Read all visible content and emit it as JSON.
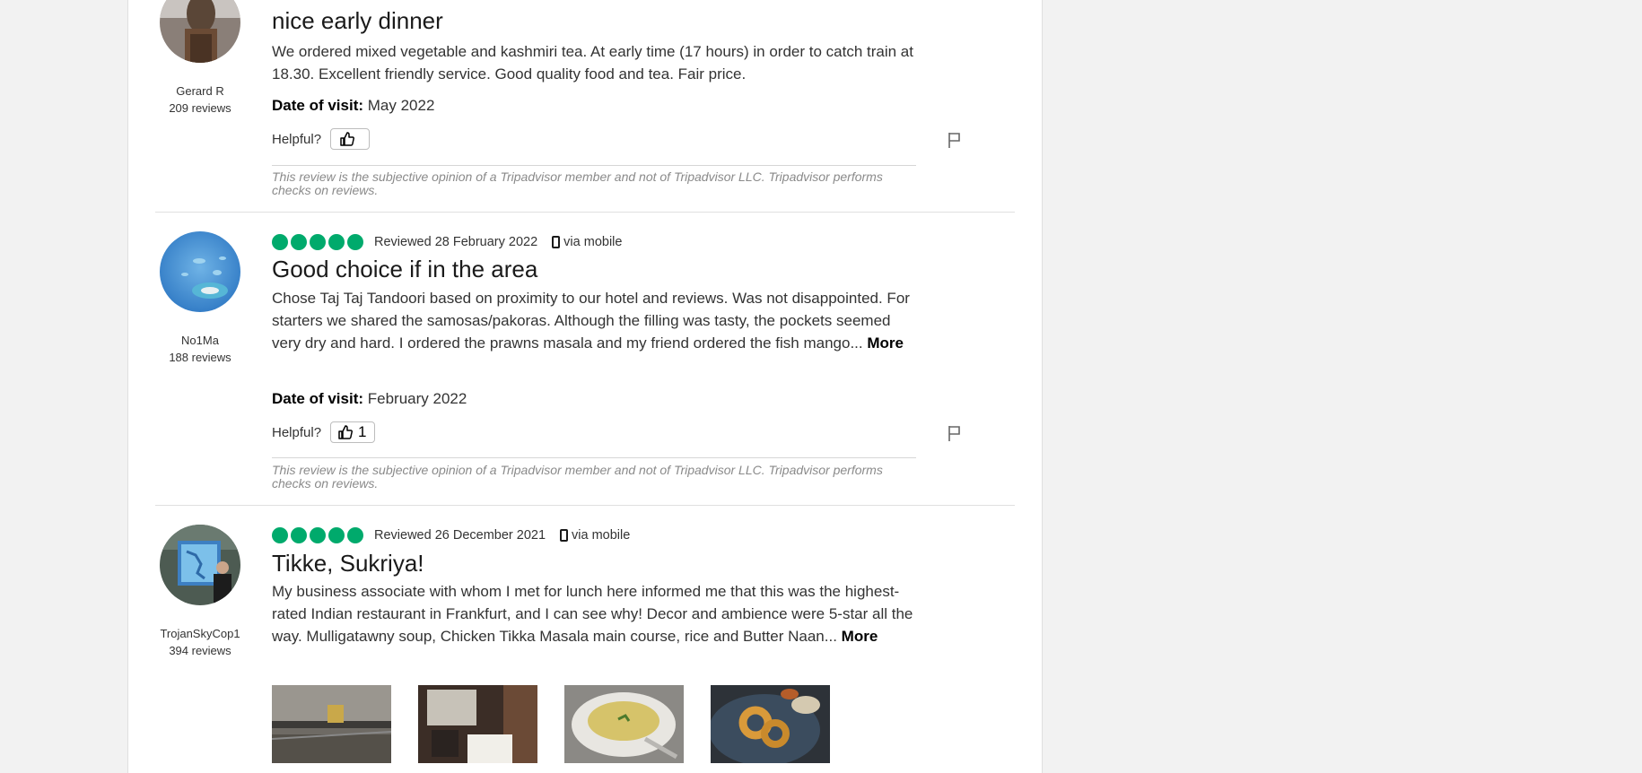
{
  "reviews": [
    {
      "title": "nice early dinner",
      "body": "We ordered mixed vegetable and kashmiri tea. At early time (17 hours) in order to catch train at 18.30. Excellent friendly service. Good quality food and tea. Fair price.",
      "date_of_visit_label": "Date of visit:",
      "date_of_visit": "May 2022",
      "helpful_label": "Helpful?",
      "helpful_count": "",
      "user": {
        "name": "Gerard R",
        "reviews": "209 reviews"
      },
      "disclaimer": "This review is the subjective opinion of a Tripadvisor member and not of Tripadvisor LLC. Tripadvisor performs checks on reviews."
    },
    {
      "rating": 5,
      "reviewed": "Reviewed 28 February 2022",
      "via": "via mobile",
      "title": "Good choice if in the area",
      "body": "Chose Taj Taj Tandoori based on proximity to our hotel and reviews. Was not disappointed. For starters we shared the samosas/pakoras. Although the filling was tasty, the pockets seemed very dry and hard. I ordered the prawns masala and my friend ordered the fish mango...",
      "more": "More",
      "date_of_visit_label": "Date of visit:",
      "date_of_visit": "February 2022",
      "helpful_label": "Helpful?",
      "helpful_count": "1",
      "user": {
        "name": "No1Ma",
        "reviews": "188 reviews"
      },
      "disclaimer": "This review is the subjective opinion of a Tripadvisor member and not of Tripadvisor LLC. Tripadvisor performs checks on reviews."
    },
    {
      "rating": 5,
      "reviewed": "Reviewed 26 December 2021",
      "via": "via mobile",
      "title": "Tikke, Sukriya!",
      "body": "My business associate with whom I met for lunch here informed me that this was the highest-rated Indian restaurant in Frankfurt, and I can see why! Decor and ambience were 5-star all the way. Mulligatawny soup, Chicken Tikka Masala main course, rice and Butter Naan...",
      "more": "More",
      "user": {
        "name": "TrojanSkyCop1",
        "reviews": "394 reviews"
      }
    }
  ],
  "colors": {
    "bubble": "#00aa6c",
    "page_bg": "#f2f2f2"
  },
  "icons": [
    "thumbs-up-icon",
    "flag-icon",
    "mobile-phone-icon"
  ]
}
